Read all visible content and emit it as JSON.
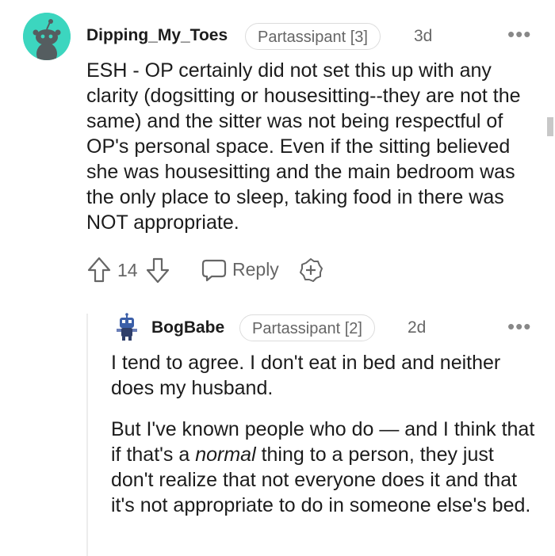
{
  "comment": {
    "username": "Dipping_My_Toes",
    "flair": "Partassipant [3]",
    "time": "3d",
    "more_label": "•••",
    "text": "ESH - OP certainly did not set this up with any clarity (dogsitting or housesitting--they are not the same) and the sitter was not being respectful of OP's personal space. Even if the sitting believed she was housesitting and the main bedroom was the only place to sleep, taking food in there was NOT appropriate.",
    "vote_count": "14",
    "reply_label": "Reply",
    "avatar_color": "#3cd6bf"
  },
  "reply": {
    "username": "BogBabe",
    "flair": "Partassipant [2]",
    "time": "2d",
    "more_label": "•••",
    "paragraph1": "I tend to agree. I don't eat in bed and neither does my husband.",
    "paragraph2_before": "But I've known people who do — and I think that if that's a ",
    "paragraph2_em": "normal",
    "paragraph2_after": " thing to a person, they just don't realize that not everyone does it and that it's not appropriate to do in someone else's bed."
  },
  "icons": {
    "upvote": "upvote-arrow-icon",
    "downvote": "downvote-arrow-icon",
    "reply": "speech-bubble-icon",
    "award": "add-award-icon"
  }
}
